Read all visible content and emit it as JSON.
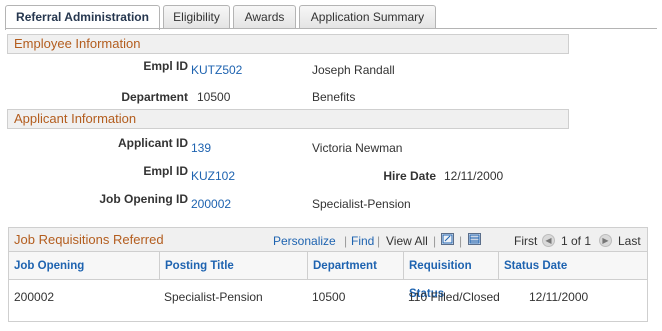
{
  "tabs": [
    {
      "label": "Referral Administration",
      "active": true
    },
    {
      "label": "Eligibility",
      "active": false
    },
    {
      "label": "Awards",
      "active": false
    },
    {
      "label": "Application Summary",
      "active": false
    }
  ],
  "employee_section": {
    "title": "Employee Information",
    "empl_id_label": "Empl ID",
    "empl_id": "KUTZ502",
    "name": "Joseph Randall",
    "department_label": "Department",
    "department_code": "10500",
    "department_name": "Benefits"
  },
  "applicant_section": {
    "title": "Applicant Information",
    "applicant_id_label": "Applicant ID",
    "applicant_id": "139",
    "applicant_name": "Victoria Newman",
    "empl_id_label": "Empl ID",
    "empl_id": "KUZ102",
    "hire_date_label": "Hire Date",
    "hire_date": "12/11/2000",
    "job_opening_id_label": "Job Opening ID",
    "job_opening_id": "200002",
    "job_opening_title": "Specialist-Pension"
  },
  "grid": {
    "title": "Job Requisitions Referred",
    "personalize": "Personalize",
    "find": "Find",
    "view_all": "View All",
    "sep": "|",
    "first": "First",
    "range": "1 of 1",
    "last": "Last",
    "columns": [
      "Job Opening",
      "Posting Title",
      "Department",
      "Requisition Status",
      "Status Date"
    ],
    "rows": [
      [
        "200002",
        "Specialist-Pension",
        "10500",
        "110 Filled/Closed",
        "12/11/2000"
      ]
    ]
  },
  "icons": {
    "new_window": "new-window-icon",
    "download": "download-grid-icon",
    "prev": "previous-arrow-icon",
    "next": "next-arrow-icon"
  }
}
